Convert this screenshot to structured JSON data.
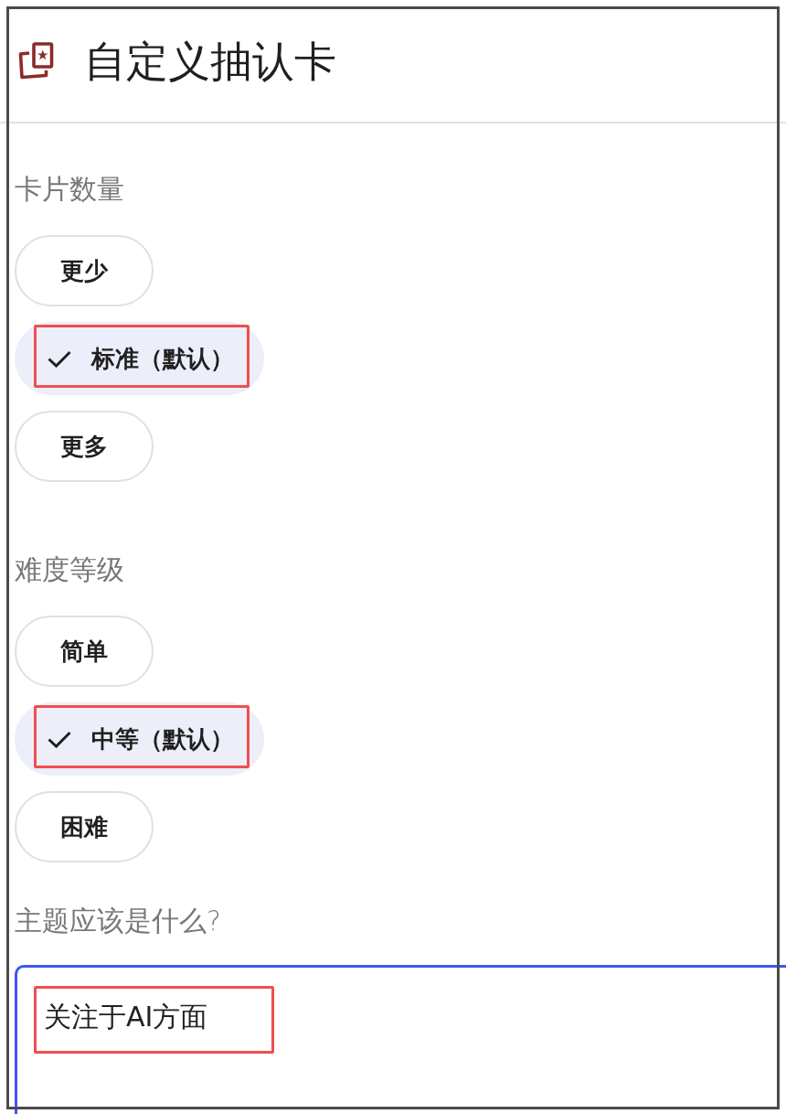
{
  "header": {
    "title": "自定义抽认卡"
  },
  "sections": [
    {
      "kind": "choice",
      "label": "卡片数量",
      "options": [
        {
          "label": "更少",
          "selected": false,
          "highlighted": false
        },
        {
          "label": "标准（默认）",
          "selected": true,
          "highlighted": true
        },
        {
          "label": "更多",
          "selected": false,
          "highlighted": false
        }
      ]
    },
    {
      "kind": "choice",
      "label": "难度等级",
      "options": [
        {
          "label": "简单",
          "selected": false,
          "highlighted": false
        },
        {
          "label": "中等（默认）",
          "selected": true,
          "highlighted": true
        },
        {
          "label": "困难",
          "selected": false,
          "highlighted": false
        }
      ]
    },
    {
      "kind": "text",
      "label": "主题应该是什么?",
      "value": "关注于AI方面",
      "focused": true,
      "highlighted": true
    }
  ]
}
